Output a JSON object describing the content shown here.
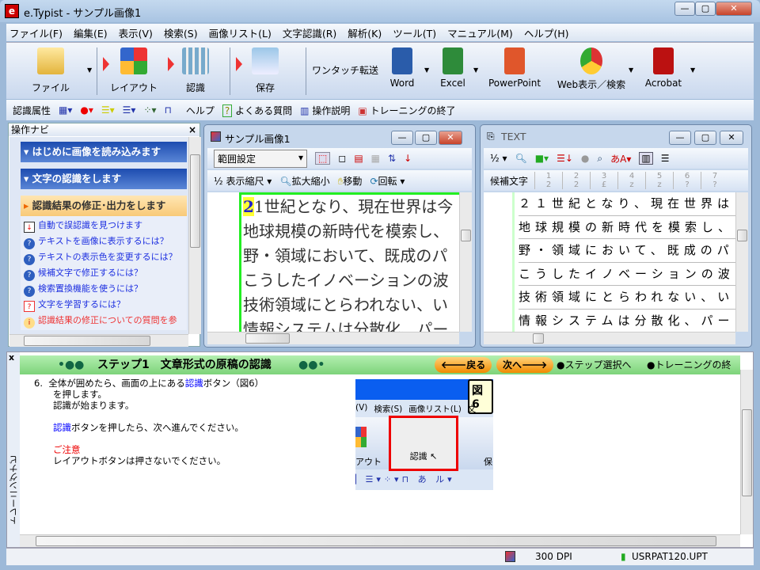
{
  "window": {
    "title": "e.Typist - サンプル画像1",
    "app_icon": "e"
  },
  "menu": [
    "ファイル(F)",
    "編集(E)",
    "表示(V)",
    "検索(S)",
    "画像リスト(L)",
    "文字認識(R)",
    "解析(K)",
    "ツール(T)",
    "マニュアル(M)",
    "ヘルプ(H)"
  ],
  "toolbar": {
    "file": "ファイル",
    "layout": "レイアウト",
    "recognize": "認識",
    "save": "保存",
    "one_touch": "ワンタッチ転送",
    "word": "Word",
    "excel": "Excel",
    "powerpoint": "PowerPoint",
    "web": "Web表示／検索",
    "acrobat": "Acrobat"
  },
  "toolbar2": {
    "attr": "認識属性",
    "help": "ヘルプ",
    "faq": "よくある質問",
    "manual": "操作説明",
    "end_training": "トレーニングの終了"
  },
  "nav": {
    "title": "操作ナビ",
    "close": "×",
    "sections": [
      "はじめに画像を読み込みます",
      "文字の認識をします",
      "認識結果の修正･出力をします"
    ],
    "links": [
      "自動で誤認識を見つけます",
      "テキストを画像に表示するには？",
      "テキストの表示色を変更するには？",
      "候補文字で修正するには？",
      "検索置換機能を使うには？",
      "文字を学習するには？",
      "認識結果の修正についての質問を参"
    ]
  },
  "image_window": {
    "title": "サンプル画像1",
    "range_select": "範囲設定",
    "scale": "表示縮尺",
    "zoom": "拡大縮小",
    "move": "移動",
    "rotate": "回転",
    "half": "½",
    "lines": [
      "21世紀となり、現在世界は今",
      "地球規模の新時代を模索し、",
      "野・領域において、既成のパ",
      "こうしたイノベーションの波",
      "技術領域にとらわれない、い",
      "情報システムは分散化、パー"
    ]
  },
  "text_window": {
    "title": "TEXT",
    "candidates_label": "候補文字",
    "half": "½",
    "candidates": [
      [
        "1",
        "2"
      ],
      [
        "2",
        "2"
      ],
      [
        "3",
        "£"
      ],
      [
        "4",
        "z"
      ],
      [
        "5",
        "z"
      ],
      [
        "6",
        "?"
      ],
      [
        "7",
        "?"
      ]
    ],
    "lines": [
      "２１世紀となり、現在世界は",
      "地球規模の新時代を模索し、",
      "野・領域において、既成のパ",
      "こうしたイノベーションの波",
      "技術領域にとらわれない、い",
      "情報システムは分散化、パー"
    ]
  },
  "training": {
    "side_label": "トレーニングナビ",
    "close": "x",
    "step": "ステップ1　文章形式の原稿の認識",
    "back": "戻る",
    "next": "次へ",
    "step_select": "●ステップ選択へ",
    "end": "●トレーニングの終",
    "num": "6.",
    "p1a": "全体が囲めたら、画面の上にある",
    "p1link": "認識",
    "p1b": "ボタン（図6）",
    "p1c": "を押します。",
    "p2": "認識が始まります。",
    "p3link": "認識",
    "p3": "ボタンを押したら、次へ進んでください。",
    "caution": "ご注意",
    "p4": "レイアウトボタンは押さないでください。",
    "fig_label": "図6",
    "fig_menu": [
      "(V)",
      "検索(S)",
      "画像リスト(L)",
      "文"
    ],
    "fig_layout": "アウト",
    "fig_recog": "認識",
    "fig_save": "保"
  },
  "status": {
    "dpi": "300 DPI",
    "pattern": "USRPAT120.UPT"
  }
}
